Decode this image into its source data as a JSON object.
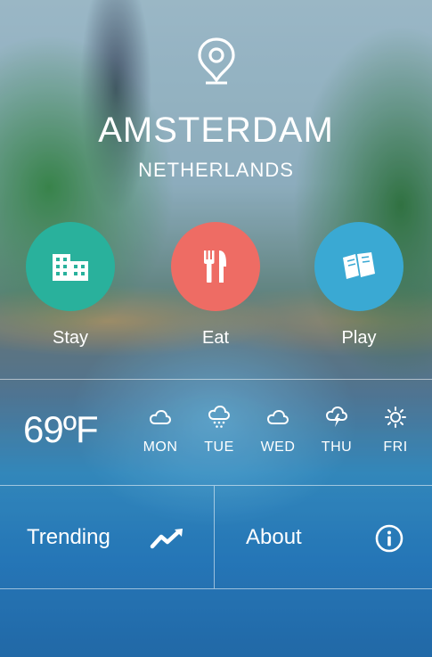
{
  "header": {
    "city": "AMSTERDAM",
    "country": "NETHERLANDS",
    "icon": "map-pin-icon"
  },
  "categories": [
    {
      "label": "Stay",
      "icon": "hotel-building-icon",
      "color": "#29b19c"
    },
    {
      "label": "Eat",
      "icon": "fork-knife-icon",
      "color": "#ee6c64"
    },
    {
      "label": "Play",
      "icon": "tickets-icon",
      "color": "#3aa9d3"
    }
  ],
  "weather": {
    "temperature": "69ºF",
    "days": [
      {
        "label": "MON",
        "icon": "cloud-icon"
      },
      {
        "label": "TUE",
        "icon": "rain-cloud-icon"
      },
      {
        "label": "WED",
        "icon": "cloud-icon"
      },
      {
        "label": "THU",
        "icon": "storm-cloud-icon"
      },
      {
        "label": "FRI",
        "icon": "sun-icon"
      }
    ]
  },
  "nav": {
    "trending": {
      "label": "Trending",
      "icon": "trending-chart-icon"
    },
    "about": {
      "label": "About",
      "icon": "info-icon"
    }
  }
}
